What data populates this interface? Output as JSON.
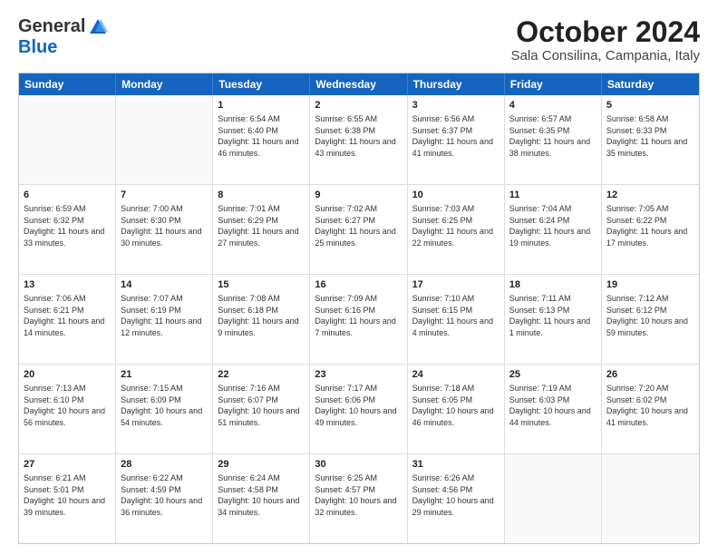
{
  "header": {
    "logo_general": "General",
    "logo_blue": "Blue",
    "month_title": "October 2024",
    "location": "Sala Consilina, Campania, Italy"
  },
  "days_of_week": [
    "Sunday",
    "Monday",
    "Tuesday",
    "Wednesday",
    "Thursday",
    "Friday",
    "Saturday"
  ],
  "rows": [
    [
      {
        "day": "",
        "empty": true,
        "text": ""
      },
      {
        "day": "",
        "empty": true,
        "text": ""
      },
      {
        "day": "1",
        "text": "Sunrise: 6:54 AM\nSunset: 6:40 PM\nDaylight: 11 hours and 46 minutes."
      },
      {
        "day": "2",
        "text": "Sunrise: 6:55 AM\nSunset: 6:38 PM\nDaylight: 11 hours and 43 minutes."
      },
      {
        "day": "3",
        "text": "Sunrise: 6:56 AM\nSunset: 6:37 PM\nDaylight: 11 hours and 41 minutes."
      },
      {
        "day": "4",
        "text": "Sunrise: 6:57 AM\nSunset: 6:35 PM\nDaylight: 11 hours and 38 minutes."
      },
      {
        "day": "5",
        "text": "Sunrise: 6:58 AM\nSunset: 6:33 PM\nDaylight: 11 hours and 35 minutes."
      }
    ],
    [
      {
        "day": "6",
        "text": "Sunrise: 6:59 AM\nSunset: 6:32 PM\nDaylight: 11 hours and 33 minutes."
      },
      {
        "day": "7",
        "text": "Sunrise: 7:00 AM\nSunset: 6:30 PM\nDaylight: 11 hours and 30 minutes."
      },
      {
        "day": "8",
        "text": "Sunrise: 7:01 AM\nSunset: 6:29 PM\nDaylight: 11 hours and 27 minutes."
      },
      {
        "day": "9",
        "text": "Sunrise: 7:02 AM\nSunset: 6:27 PM\nDaylight: 11 hours and 25 minutes."
      },
      {
        "day": "10",
        "text": "Sunrise: 7:03 AM\nSunset: 6:25 PM\nDaylight: 11 hours and 22 minutes."
      },
      {
        "day": "11",
        "text": "Sunrise: 7:04 AM\nSunset: 6:24 PM\nDaylight: 11 hours and 19 minutes."
      },
      {
        "day": "12",
        "text": "Sunrise: 7:05 AM\nSunset: 6:22 PM\nDaylight: 11 hours and 17 minutes."
      }
    ],
    [
      {
        "day": "13",
        "text": "Sunrise: 7:06 AM\nSunset: 6:21 PM\nDaylight: 11 hours and 14 minutes."
      },
      {
        "day": "14",
        "text": "Sunrise: 7:07 AM\nSunset: 6:19 PM\nDaylight: 11 hours and 12 minutes."
      },
      {
        "day": "15",
        "text": "Sunrise: 7:08 AM\nSunset: 6:18 PM\nDaylight: 11 hours and 9 minutes."
      },
      {
        "day": "16",
        "text": "Sunrise: 7:09 AM\nSunset: 6:16 PM\nDaylight: 11 hours and 7 minutes."
      },
      {
        "day": "17",
        "text": "Sunrise: 7:10 AM\nSunset: 6:15 PM\nDaylight: 11 hours and 4 minutes."
      },
      {
        "day": "18",
        "text": "Sunrise: 7:11 AM\nSunset: 6:13 PM\nDaylight: 11 hours and 1 minute."
      },
      {
        "day": "19",
        "text": "Sunrise: 7:12 AM\nSunset: 6:12 PM\nDaylight: 10 hours and 59 minutes."
      }
    ],
    [
      {
        "day": "20",
        "text": "Sunrise: 7:13 AM\nSunset: 6:10 PM\nDaylight: 10 hours and 56 minutes."
      },
      {
        "day": "21",
        "text": "Sunrise: 7:15 AM\nSunset: 6:09 PM\nDaylight: 10 hours and 54 minutes."
      },
      {
        "day": "22",
        "text": "Sunrise: 7:16 AM\nSunset: 6:07 PM\nDaylight: 10 hours and 51 minutes."
      },
      {
        "day": "23",
        "text": "Sunrise: 7:17 AM\nSunset: 6:06 PM\nDaylight: 10 hours and 49 minutes."
      },
      {
        "day": "24",
        "text": "Sunrise: 7:18 AM\nSunset: 6:05 PM\nDaylight: 10 hours and 46 minutes."
      },
      {
        "day": "25",
        "text": "Sunrise: 7:19 AM\nSunset: 6:03 PM\nDaylight: 10 hours and 44 minutes."
      },
      {
        "day": "26",
        "text": "Sunrise: 7:20 AM\nSunset: 6:02 PM\nDaylight: 10 hours and 41 minutes."
      }
    ],
    [
      {
        "day": "27",
        "text": "Sunrise: 6:21 AM\nSunset: 5:01 PM\nDaylight: 10 hours and 39 minutes."
      },
      {
        "day": "28",
        "text": "Sunrise: 6:22 AM\nSunset: 4:59 PM\nDaylight: 10 hours and 36 minutes."
      },
      {
        "day": "29",
        "text": "Sunrise: 6:24 AM\nSunset: 4:58 PM\nDaylight: 10 hours and 34 minutes."
      },
      {
        "day": "30",
        "text": "Sunrise: 6:25 AM\nSunset: 4:57 PM\nDaylight: 10 hours and 32 minutes."
      },
      {
        "day": "31",
        "text": "Sunrise: 6:26 AM\nSunset: 4:56 PM\nDaylight: 10 hours and 29 minutes."
      },
      {
        "day": "",
        "empty": true,
        "text": ""
      },
      {
        "day": "",
        "empty": true,
        "text": ""
      }
    ]
  ]
}
